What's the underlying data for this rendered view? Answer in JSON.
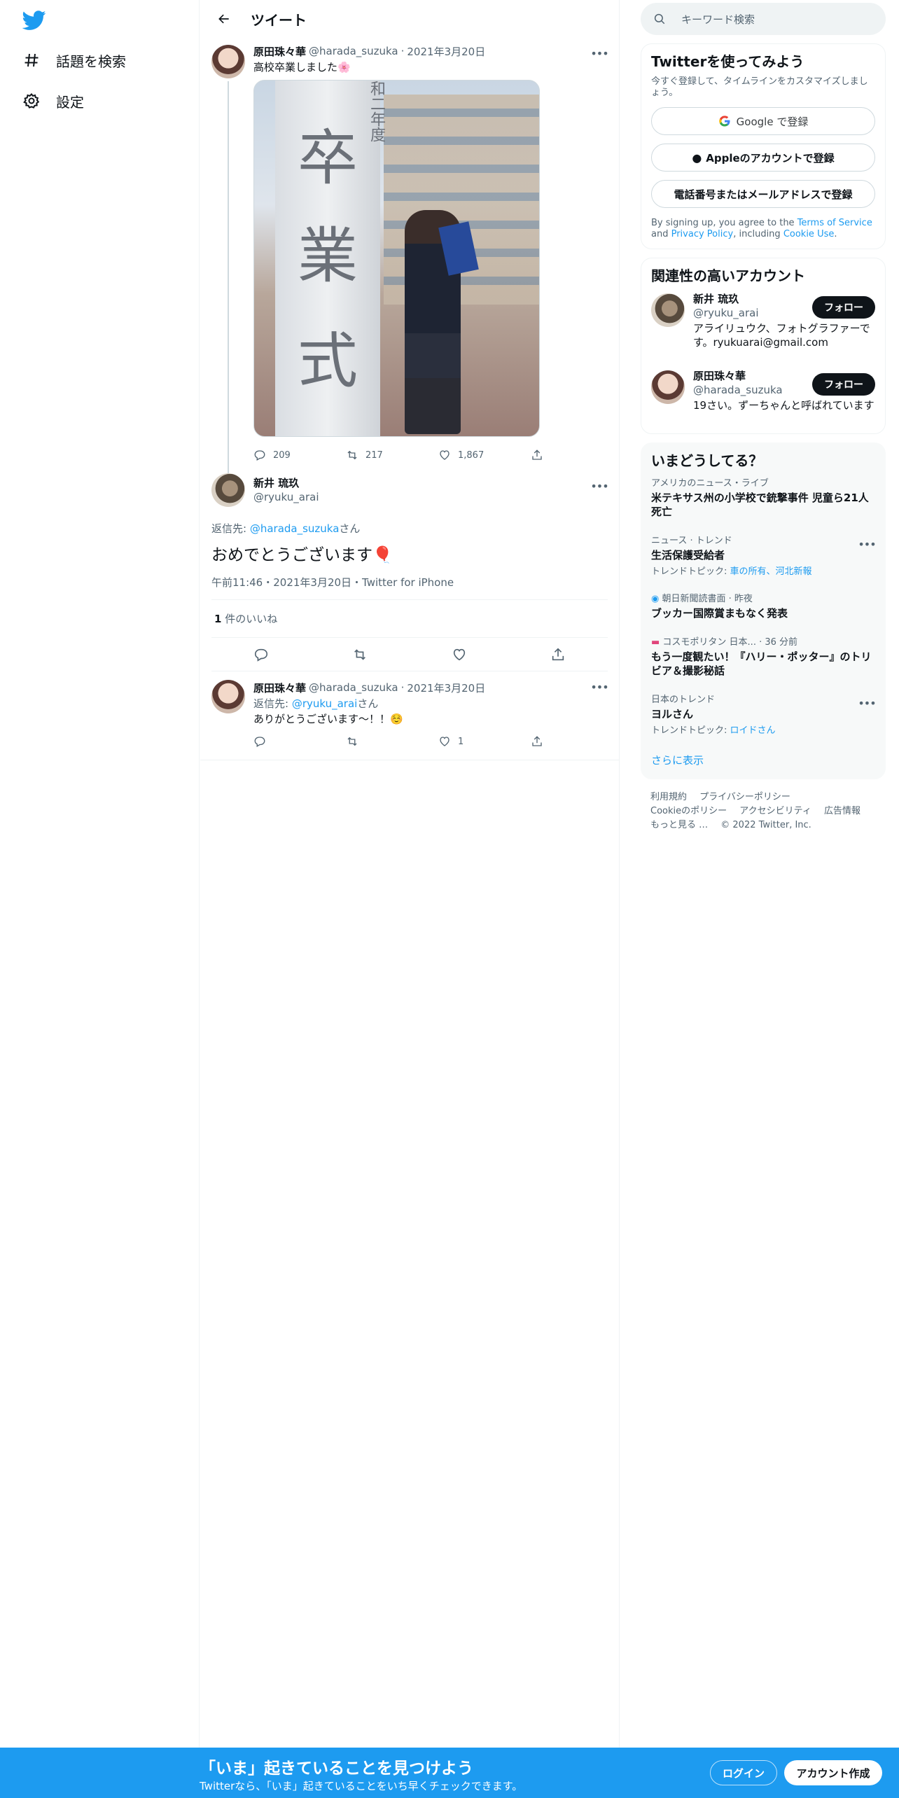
{
  "nav": {
    "explore_label": "話題を検索",
    "settings_label": "設定"
  },
  "header": {
    "title": "ツイート"
  },
  "thread": {
    "first": {
      "name": "原田珠々華",
      "handle": "@harada_suzuka",
      "date": "2021年3月20日",
      "text": "高校卒業しました🌸",
      "media_chars": [
        "卒",
        "業",
        "式"
      ],
      "media_caption": "和二年度",
      "replies": "209",
      "retweets": "217",
      "likes": "1,867"
    },
    "focus": {
      "name": "新井 琉玖",
      "handle": "@ryuku_arai",
      "reply_prefix": "返信先: ",
      "reply_to": "@harada_suzuka",
      "reply_suffix": "さん",
      "text": "おめでとうございます🎈",
      "meta": "午前11:46・2021年3月20日・Twitter for iPhone",
      "likes_count": "1",
      "likes_label": " 件のいいね"
    },
    "reply": {
      "name": "原田珠々華",
      "handle": "@harada_suzuka",
      "date": "2021年3月20日",
      "reply_prefix": "返信先: ",
      "reply_to": "@ryuku_arai",
      "reply_suffix": "さん",
      "text": "ありがとうございます〜！！☺️",
      "likes": "1"
    }
  },
  "search": {
    "placeholder": "キーワード検索"
  },
  "signup_card": {
    "title": "Twitterを使ってみよう",
    "sub": "今すぐ登録して、タイムラインをカスタマイズしましょう。",
    "google": "Google で登録",
    "apple": "Appleのアカウントで登録",
    "phone": "電話番号またはメールアドレスで登録",
    "legal_1": "By signing up, you agree to the ",
    "tos": "Terms of Service",
    "legal_2": " and ",
    "privacy": "Privacy Policy",
    "legal_3": ", including ",
    "cookie": "Cookie Use",
    "legal_4": "."
  },
  "related": {
    "title": "関連性の高いアカウント",
    "follow_label": "フォロー",
    "accounts": [
      {
        "name": "新井 琉玖",
        "handle": "@ryuku_arai",
        "bio": "アライリュウク、フォトグラファーです。ryukuarai@gmail.com"
      },
      {
        "name": "原田珠々華",
        "handle": "@harada_suzuka",
        "bio": "19さい。ずーちゃんと呼ばれています"
      }
    ]
  },
  "trends": {
    "title": "いまどうしてる？",
    "items": [
      {
        "context": "アメリカのニュース・ライブ",
        "title": "米テキサス州の小学校で銃撃事件 児童ら21人死亡",
        "topic": ""
      },
      {
        "context": "ニュース · トレンド",
        "title": "生活保護受給者",
        "topic_prefix": "トレンドトピック: ",
        "topic": "車の所有、河北新報"
      },
      {
        "context": "朝日新聞読書面 · 昨夜",
        "title": "ブッカー国際賞まもなく発表",
        "topic": ""
      },
      {
        "context": "コスモポリタン 日本... · 36 分前",
        "title": "もう一度観たい！『ハリー・ポッター』のトリビア＆撮影秘話",
        "topic": ""
      },
      {
        "context": "日本のトレンド",
        "title": "ヨルさん",
        "topic_prefix": "トレンドトピック: ",
        "topic": "ロイドさん"
      }
    ],
    "show_more": "さらに表示"
  },
  "footer": {
    "links": [
      "利用規約",
      "プライバシーポリシー",
      "Cookieのポリシー",
      "アクセシビリティ",
      "広告情報",
      "もっと見る …",
      "© 2022 Twitter, Inc."
    ]
  },
  "bottom_bar": {
    "title": "「いま」起きていることを見つけよう",
    "sub": "Twitterなら、「いま」起きていることをいち早くチェックできます。",
    "login": "ログイン",
    "signup": "アカウント作成"
  },
  "colors": {
    "accent": "#1d9bf0",
    "text": "#0f1419",
    "muted": "#536471"
  }
}
